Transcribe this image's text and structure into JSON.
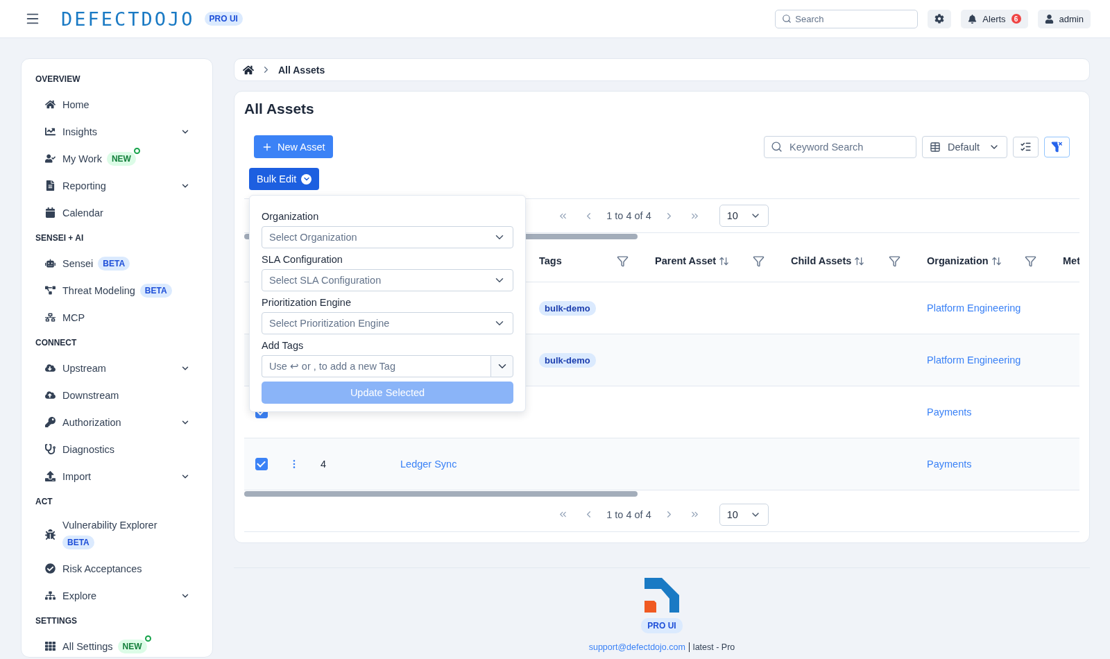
{
  "header": {
    "logo": "DEFECTDOJO",
    "logo_badge": "PRO UI",
    "search": {
      "placeholder": "Search"
    },
    "alerts": {
      "label": "Alerts",
      "count": "6"
    },
    "user": "admin"
  },
  "sidebar": {
    "sections": [
      {
        "title": "OVERVIEW",
        "items": [
          {
            "label": "Home",
            "expandable": false
          },
          {
            "label": "Insights",
            "expandable": true
          },
          {
            "label": "My Work",
            "expandable": false,
            "badge": {
              "text": "NEW",
              "kind": "new"
            }
          },
          {
            "label": "Reporting",
            "expandable": true
          },
          {
            "label": "Calendar",
            "expandable": false
          }
        ]
      },
      {
        "title": "SENSEI + AI",
        "items": [
          {
            "label": "Sensei",
            "expandable": false,
            "badge": {
              "text": "BETA",
              "kind": "beta"
            }
          },
          {
            "label": "Threat Modeling",
            "expandable": false,
            "badge": {
              "text": "BETA",
              "kind": "beta"
            }
          },
          {
            "label": "MCP",
            "expandable": false
          }
        ]
      },
      {
        "title": "CONNECT",
        "items": [
          {
            "label": "Upstream",
            "expandable": true
          },
          {
            "label": "Downstream",
            "expandable": false
          },
          {
            "label": "Authorization",
            "expandable": true
          },
          {
            "label": "Diagnostics",
            "expandable": false
          },
          {
            "label": "Import",
            "expandable": true
          }
        ]
      },
      {
        "title": "ACT",
        "items": [
          {
            "label": "Vulnerability Explorer",
            "expandable": false,
            "badge": {
              "text": "BETA",
              "kind": "beta"
            }
          },
          {
            "label": "Risk Acceptances",
            "expandable": false
          },
          {
            "label": "Explore",
            "expandable": true
          }
        ]
      },
      {
        "title": "SETTINGS",
        "items": [
          {
            "label": "All Settings",
            "expandable": false,
            "badge": {
              "text": "NEW",
              "kind": "new"
            }
          }
        ]
      }
    ]
  },
  "breadcrumb": [
    "All Assets"
  ],
  "title": "All Assets",
  "new_button": "New Asset",
  "keyword_search": {
    "placeholder": "Keyword Search"
  },
  "view_select": "Default",
  "bulk_edit": {
    "label": "Bulk Edit",
    "expanded": true,
    "fields": [
      {
        "label": "Organization",
        "placeholder": "Select Organization",
        "kind": "select"
      },
      {
        "label": "SLA Configuration",
        "placeholder": "Select SLA Configuration",
        "kind": "select"
      },
      {
        "label": "Prioritization Engine",
        "placeholder": "Select Prioritization Engine",
        "kind": "select"
      },
      {
        "label": "Add Tags",
        "placeholder": "Use ↩ or , to add a new Tag",
        "kind": "tags"
      }
    ],
    "submit": {
      "label": "Update Selected",
      "disabled": true
    }
  },
  "pagination": [
    {
      "range": "1 to 4 of 4",
      "page_size": "10"
    },
    {
      "range": "1 to 4 of 4",
      "page_size": "10"
    }
  ],
  "table": {
    "columns": [
      {
        "label": "Tags",
        "sortable": false
      },
      {
        "label": "Parent Asset",
        "sortable": true
      },
      {
        "label": "Child Assets",
        "sortable": true
      },
      {
        "label": "Organization",
        "sortable": true
      },
      {
        "label": "Met",
        "sortable": false
      }
    ],
    "rows": [
      {
        "tags": [
          "bulk-demo"
        ],
        "organization": "Platform Engineering"
      },
      {
        "tags": [
          "bulk-demo"
        ],
        "organization": "Platform Engineering"
      },
      {
        "checked": true,
        "tags": [],
        "organization": "Payments"
      },
      {
        "checked": true,
        "id": "4",
        "name": "Ledger Sync",
        "tags": [],
        "organization": "Payments"
      }
    ]
  },
  "footer": {
    "badge": "PRO UI",
    "email": "support@defectdojo.com",
    "version": "latest - Pro"
  }
}
